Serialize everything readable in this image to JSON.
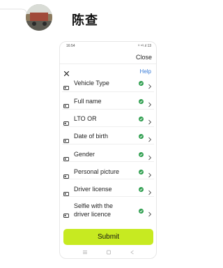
{
  "chat": {
    "contact_name": "陈查"
  },
  "phone": {
    "status_time": "16:54",
    "status_icons": "ᴵᴵ ⁵ᴳ.ıl 13",
    "close_label": "Close",
    "help_label": "Help",
    "items": [
      {
        "label": "Vehicle Type",
        "status": "complete"
      },
      {
        "label": "Full name",
        "status": "complete"
      },
      {
        "label": "LTO OR",
        "status": "complete"
      },
      {
        "label": "Date of birth",
        "status": "complete"
      },
      {
        "label": "Gender",
        "status": "complete"
      },
      {
        "label": "Personal picture",
        "status": "complete"
      },
      {
        "label": "Driver license",
        "status": "complete"
      },
      {
        "label_line1": "Selfie with the",
        "label_line2": "driver licence",
        "status": "complete"
      }
    ],
    "submit_label": "Submit",
    "accent_color": "#c7ea21",
    "check_color": "#2e9e4e",
    "help_color": "#3b7dd8"
  }
}
